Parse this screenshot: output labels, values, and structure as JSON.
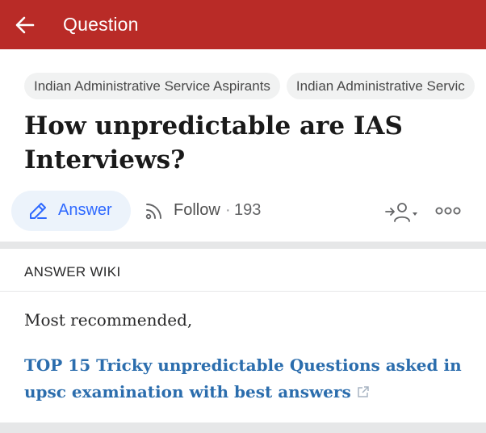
{
  "appbar": {
    "title": "Question",
    "back_icon": "arrow-left-icon",
    "color": "#b92b27"
  },
  "topics": [
    {
      "label": "Indian Administrative Service Aspirants"
    },
    {
      "label": "Indian Administrative Servic"
    }
  ],
  "question": {
    "title": "How unpredictable are IAS Interviews?"
  },
  "actions": {
    "answer_label": "Answer",
    "answer_icon": "pencil-edit-icon",
    "follow_label": "Follow",
    "follow_separator": "·",
    "follow_count": "193",
    "follow_icon": "rss-feed-icon",
    "request_icon": "request-user-icon",
    "more_icon": "more-horizontal-icon"
  },
  "answer_wiki": {
    "header": "ANSWER WIKI",
    "intro": "Most recommended,",
    "link_text": "TOP 15 Tricky unpredictable Questions asked in upsc examination with best answers",
    "link_icon": "external-link-icon"
  },
  "colors": {
    "accent_blue": "#2e69ff",
    "link_blue": "#2b6dad",
    "chip_bg": "#f1f2f2",
    "answer_bg": "#ecf3fb"
  }
}
